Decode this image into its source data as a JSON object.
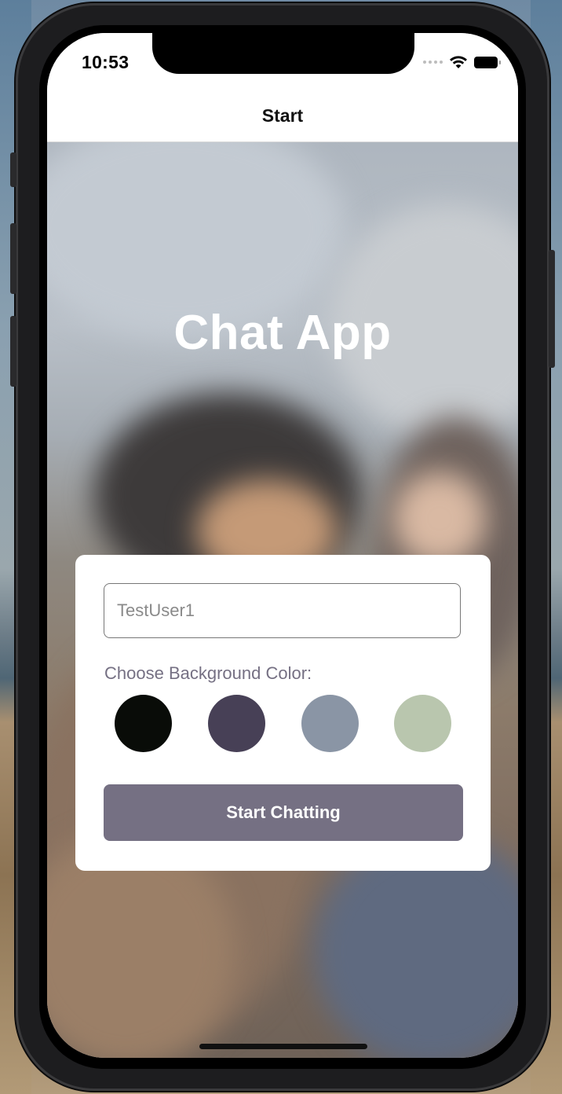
{
  "status_bar": {
    "time": "10:53",
    "icons": [
      "cellular-dots-icon",
      "wifi-icon",
      "battery-icon"
    ]
  },
  "nav": {
    "title": "Start"
  },
  "hero": {
    "title": "Chat App"
  },
  "form": {
    "name_input": {
      "value": "",
      "placeholder": "TestUser1"
    },
    "color_label": "Choose Background Color:",
    "colors": [
      "#090C08",
      "#474056",
      "#8A95A5",
      "#B9C6AE"
    ],
    "start_button_label": "Start Chatting",
    "accent_color": "#757083"
  }
}
